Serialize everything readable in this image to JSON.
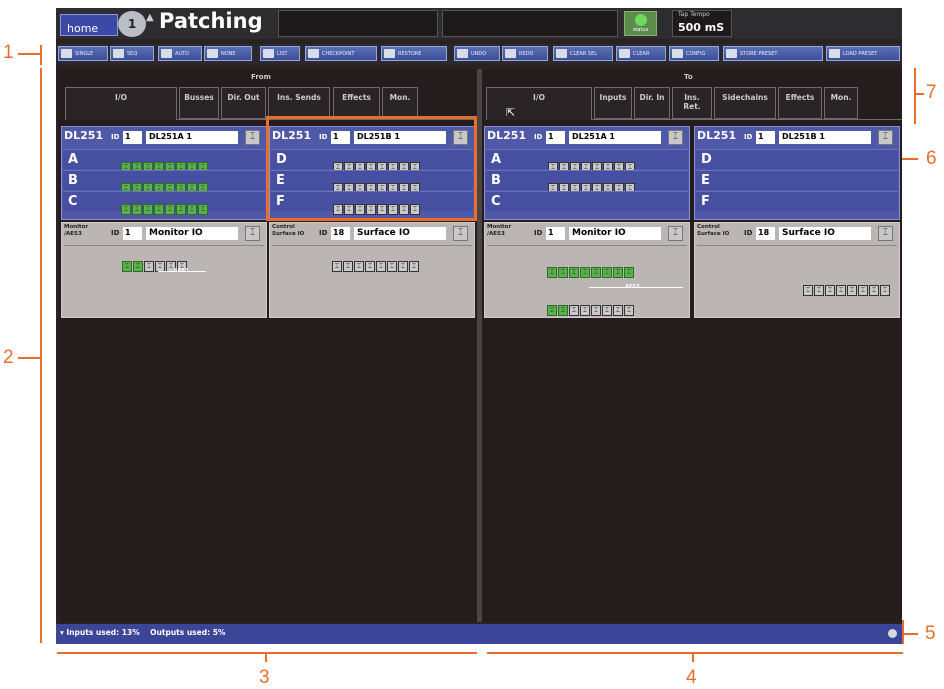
{
  "callouts": {
    "c1": "1",
    "c2": "2",
    "c3": "3",
    "c4": "4",
    "c5": "5",
    "c6": "6",
    "c7": "7"
  },
  "header": {
    "home": "home",
    "knob": "1",
    "title": "Patching",
    "status": "status",
    "tap_label": "Tap Tempo",
    "tap_value": "500 mS"
  },
  "toolbar": [
    "SINGLE",
    "SEQ",
    "AUTO",
    "NONE",
    "LIST",
    "CHECKPOINT",
    "RESTORE",
    "UNDO",
    "REDO",
    "CLEAR SEL",
    "CLEAR",
    "CONFIG",
    "STORE PRESET",
    "LOAD PRESET"
  ],
  "from": {
    "heading": "From",
    "tabs": [
      "I/O",
      "Busses",
      "Dir. Out",
      "Ins. Sends",
      "Effects",
      "Mon."
    ]
  },
  "to": {
    "heading": "To",
    "tabs": [
      "I/O",
      "Inputs",
      "Dir. In",
      "Ins. Ret.",
      "Sidechains",
      "Effects",
      "Mon."
    ]
  },
  "devices": {
    "f1": {
      "name": "DL251",
      "id_label": "ID",
      "id": "1",
      "label": "DL251A 1",
      "rows": [
        "A",
        "B",
        "C"
      ]
    },
    "f2": {
      "name": "DL251",
      "id_label": "ID",
      "id": "1",
      "label": "DL251B 1",
      "rows": [
        "D",
        "E",
        "F"
      ]
    },
    "f3": {
      "name": "Monitor /AES3",
      "id_label": "ID",
      "id": "1",
      "label": "Monitor IO",
      "aes": "AES3"
    },
    "f4": {
      "name": "Control Surface IO",
      "id_label": "ID",
      "id": "18",
      "label": "Surface IO"
    },
    "t1": {
      "name": "DL251",
      "id_label": "ID",
      "id": "1",
      "label": "DL251A 1",
      "rows": [
        "A",
        "B",
        "C"
      ]
    },
    "t2": {
      "name": "DL251",
      "id_label": "ID",
      "id": "1",
      "label": "DL251B 1",
      "rows": [
        "D",
        "E",
        "F"
      ]
    },
    "t3": {
      "name": "Monitor /AES3",
      "id_label": "ID",
      "id": "1",
      "label": "Monitor IO",
      "aes": "AES3"
    },
    "t4": {
      "name": "Control Surface IO",
      "id_label": "ID",
      "id": "18",
      "label": "Surface IO"
    }
  },
  "statusbar": {
    "inputs": "Inputs used: 13%",
    "outputs": "Outputs used: 5%"
  },
  "colors": {
    "accent": "#e96e2c",
    "panel": "#5058a8",
    "port_on": "#5bb04e"
  }
}
